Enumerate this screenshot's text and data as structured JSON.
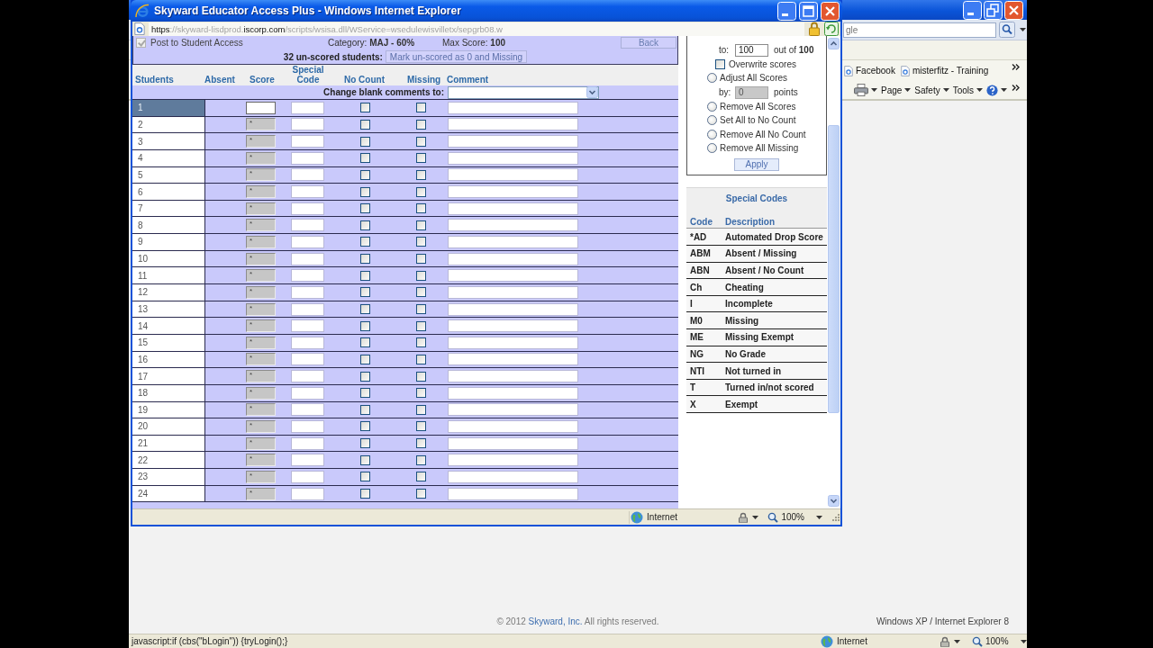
{
  "browser": {
    "search": {
      "placeholder": "gle"
    },
    "favorites": [
      {
        "label": "Facebook"
      },
      {
        "label": "misterfitz - Training"
      }
    ],
    "commands": [
      {
        "label": "Page"
      },
      {
        "label": "Safety"
      },
      {
        "label": "Tools"
      }
    ],
    "footer": {
      "text_before": "© 2012",
      "link": "Skyward, Inc.",
      "text_after": "All rights reserved.",
      "platform": "Windows XP / Internet Explorer 8"
    },
    "status_bar": {
      "message": "javascript:if (cbs(\"bLogin\")) {tryLogin();}",
      "zone": "Internet",
      "zoom": "100%"
    }
  },
  "popup": {
    "title": "Skyward Educator Access Plus - Windows Internet Explorer",
    "address": [
      {
        "text": "https",
        "kind": "strong"
      },
      {
        "text": "://skyward-lisdprod.",
        "kind": "faint"
      },
      {
        "text": "iscorp.com",
        "kind": "strong"
      },
      {
        "text": "/scripts/wsisa.dll/WService=wsedulewisvilletx/sepgrb08.w",
        "kind": "faint"
      }
    ],
    "header": {
      "post": {
        "label": "Post to Student Access",
        "checked": true,
        "disabled": true
      },
      "category": "Category: **MAJ - 60%**",
      "max_score": "Max Score: **100**",
      "back": "Back",
      "unscored_label": "32 un-scored students:",
      "unscored_action": "Mark un-scored as 0 and Missing"
    },
    "table": {
      "columns": [
        {
          "label": "Students"
        },
        {
          "label": "Absent"
        },
        {
          "label": "Score"
        },
        {
          "label": "Special Code"
        },
        {
          "label": "No Count"
        },
        {
          "label": "Missing"
        },
        {
          "label": "Comment"
        }
      ],
      "blank_comments_label": "Change blank comments to:",
      "rows": [
        {
          "student": "1",
          "selected": true,
          "score_locked": false,
          "no_count": false,
          "missing": false
        },
        {
          "student": "2",
          "selected": false,
          "score_locked": true,
          "score": "*",
          "no_count": false,
          "missing": false
        },
        {
          "student": "3",
          "selected": false,
          "score_locked": true,
          "score": "*",
          "no_count": false,
          "missing": false
        },
        {
          "student": "4",
          "selected": false,
          "score_locked": true,
          "score": "*",
          "no_count": false,
          "missing": false
        },
        {
          "student": "5",
          "selected": false,
          "score_locked": true,
          "score": "*",
          "no_count": false,
          "missing": false
        },
        {
          "student": "6",
          "selected": false,
          "score_locked": true,
          "score": "*",
          "no_count": false,
          "missing": false
        },
        {
          "student": "7",
          "selected": false,
          "score_locked": true,
          "score": "*",
          "no_count": false,
          "missing": false
        },
        {
          "student": "8",
          "selected": false,
          "score_locked": true,
          "score": "*",
          "no_count": false,
          "missing": false
        },
        {
          "student": "9",
          "selected": false,
          "score_locked": true,
          "score": "*",
          "no_count": false,
          "missing": false
        },
        {
          "student": "10",
          "selected": false,
          "score_locked": true,
          "score": "*",
          "no_count": false,
          "missing": false
        },
        {
          "student": "11",
          "selected": false,
          "score_locked": true,
          "score": "*",
          "no_count": false,
          "missing": false
        },
        {
          "student": "12",
          "selected": false,
          "score_locked": true,
          "score": "*",
          "no_count": false,
          "missing": false
        },
        {
          "student": "13",
          "selected": false,
          "score_locked": true,
          "score": "*",
          "no_count": false,
          "missing": false
        },
        {
          "student": "14",
          "selected": false,
          "score_locked": true,
          "score": "*",
          "no_count": false,
          "missing": false
        },
        {
          "student": "15",
          "selected": false,
          "score_locked": true,
          "score": "*",
          "no_count": false,
          "missing": false
        },
        {
          "student": "16",
          "selected": false,
          "score_locked": true,
          "score": "*",
          "no_count": false,
          "missing": false
        },
        {
          "student": "17",
          "selected": false,
          "score_locked": true,
          "score": "*",
          "no_count": false,
          "missing": false
        },
        {
          "student": "18",
          "selected": false,
          "score_locked": true,
          "score": "*",
          "no_count": false,
          "missing": false
        },
        {
          "student": "19",
          "selected": false,
          "score_locked": true,
          "score": "*",
          "no_count": false,
          "missing": false
        },
        {
          "student": "20",
          "selected": false,
          "score_locked": true,
          "score": "*",
          "no_count": false,
          "missing": false
        },
        {
          "student": "21",
          "selected": false,
          "score_locked": true,
          "score": "*",
          "no_count": false,
          "missing": false
        },
        {
          "student": "22",
          "selected": false,
          "score_locked": true,
          "score": "*",
          "no_count": false,
          "missing": false
        },
        {
          "student": "23",
          "selected": false,
          "score_locked": true,
          "score": "*",
          "no_count": false,
          "missing": false
        },
        {
          "student": "24",
          "selected": false,
          "score_locked": true,
          "score": "*",
          "no_count": false,
          "missing": false
        }
      ]
    },
    "score_tools": {
      "items": [
        {
          "kind": "value",
          "label": "to:",
          "value": "100",
          "suffix": "out of **100**",
          "disabled": false
        },
        {
          "kind": "checkbox",
          "label": "Overwrite scores",
          "checked": false
        },
        {
          "kind": "radio",
          "label": "Adjust All Scores",
          "selected": false
        },
        {
          "kind": "value",
          "label": "by:",
          "value": "0",
          "suffix": "points",
          "disabled": true
        },
        {
          "kind": "radio",
          "label": "Remove All Scores",
          "selected": false
        },
        {
          "kind": "radio",
          "label": "Set All to No Count",
          "selected": false
        },
        {
          "kind": "radio",
          "label": "Remove All No Count",
          "selected": false
        },
        {
          "kind": "radio",
          "label": "Remove All Missing",
          "selected": false
        }
      ],
      "apply": "Apply"
    },
    "special_codes": {
      "title": "Special Codes",
      "columns": [
        "Code",
        "Description"
      ],
      "rows": [
        {
          "code": "*AD",
          "description": "Automated Drop Score"
        },
        {
          "code": "ABM",
          "description": "Absent / Missing"
        },
        {
          "code": "ABN",
          "description": "Absent / No Count"
        },
        {
          "code": "Ch",
          "description": "Cheating"
        },
        {
          "code": "I",
          "description": "Incomplete"
        },
        {
          "code": "M0",
          "description": "Missing"
        },
        {
          "code": "ME",
          "description": "Missing Exempt"
        },
        {
          "code": "NG",
          "description": "No Grade"
        },
        {
          "code": "NTI",
          "description": "Not turned in"
        },
        {
          "code": "T",
          "description": "Turned in/not scored"
        },
        {
          "code": "X",
          "description": "Exempt"
        }
      ]
    },
    "status_bar": {
      "zone": "Internet",
      "zoom": "100%"
    }
  }
}
